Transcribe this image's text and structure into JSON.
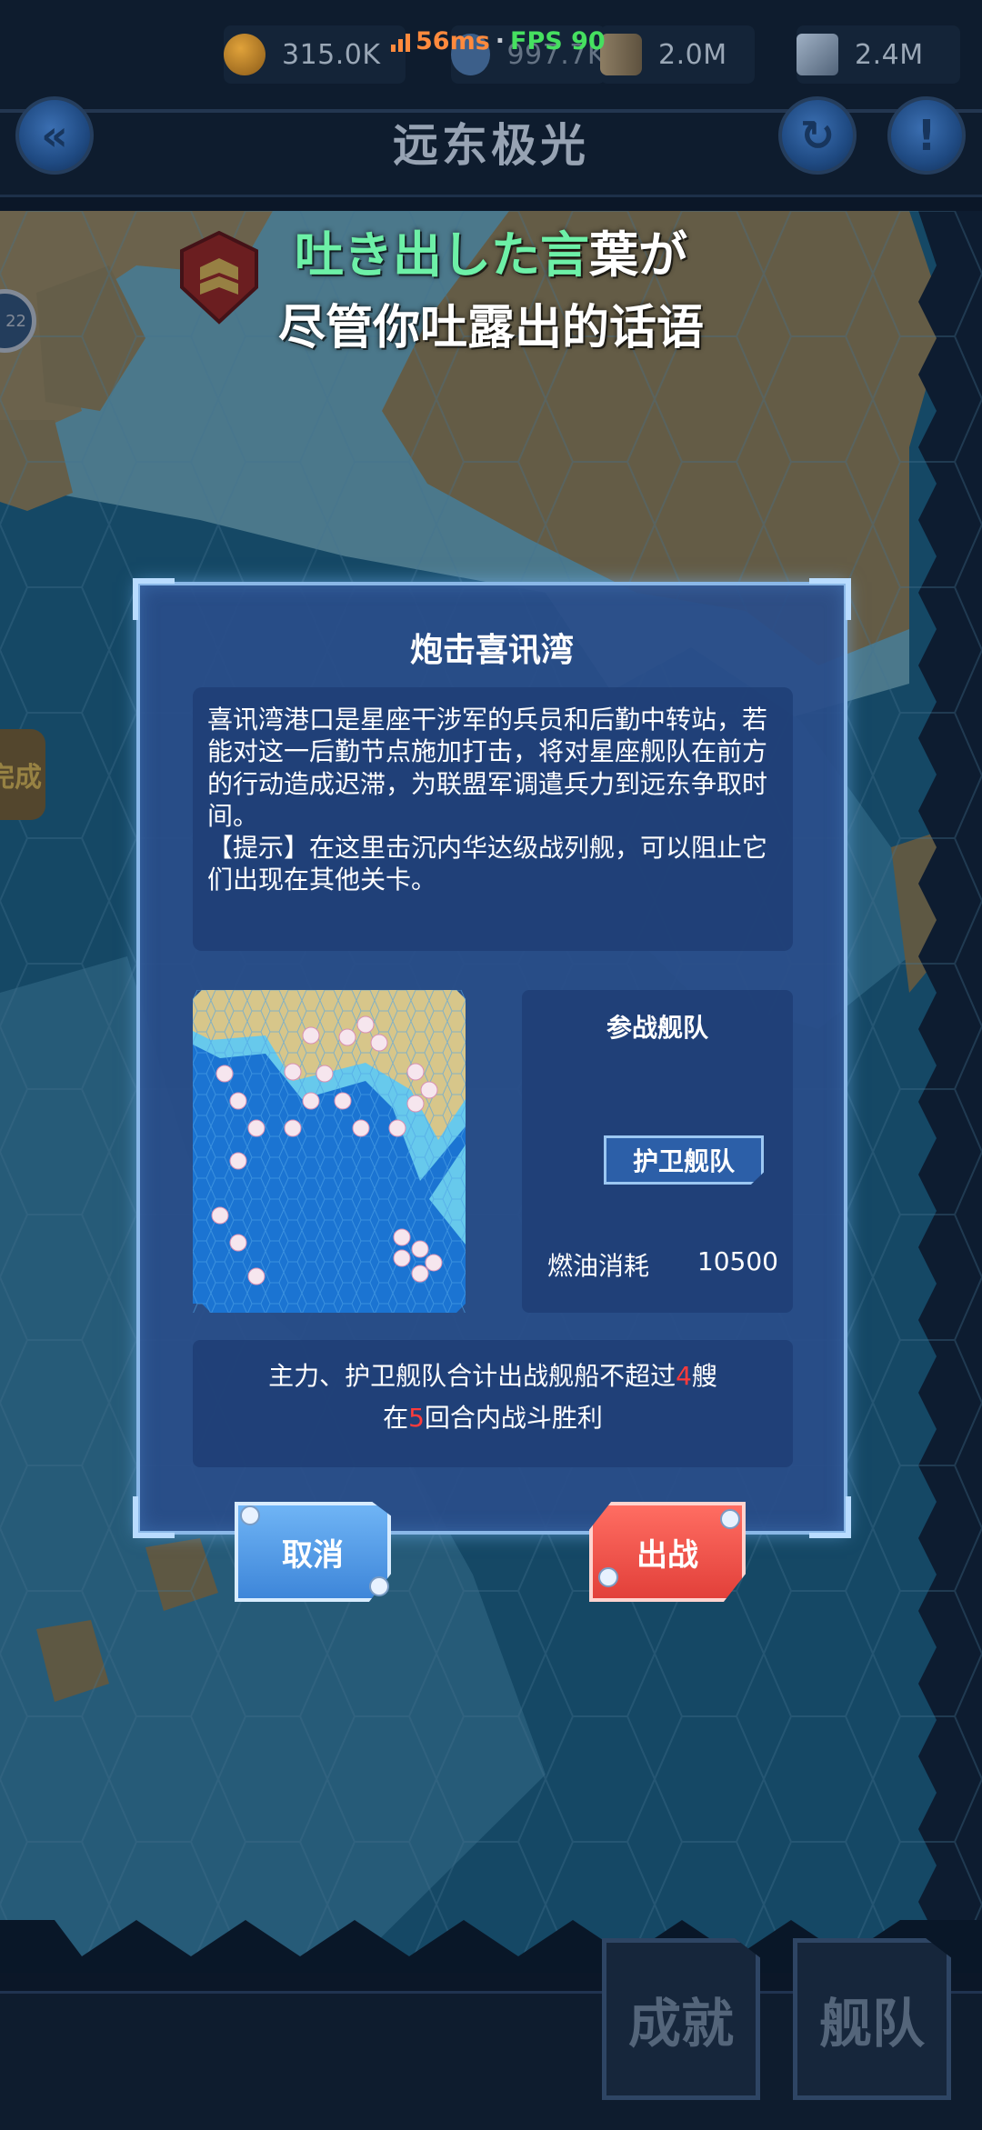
{
  "topbar": {
    "perf_ping": "56ms",
    "perf_sep": "·",
    "perf_fps": "FPS 90",
    "resources": [
      {
        "name": "coin",
        "value": "315.0K"
      },
      {
        "name": "oil",
        "value": "997.7K"
      },
      {
        "name": "ammo",
        "value": "2.0M"
      },
      {
        "name": "steel",
        "value": "2.4M"
      }
    ]
  },
  "header": {
    "title": "远东极光",
    "back_icon": "double-chevron-left-icon",
    "refresh_icon": "refresh-icon",
    "info_icon": "exclamation-icon"
  },
  "lyrics": {
    "line1_green": "吐き出した言",
    "line1_white": "葉が",
    "line2": "尽管你吐露出的话语"
  },
  "map_labels": {
    "node_left_badge": "22",
    "node_left_text": "完成"
  },
  "dialog": {
    "title": "炮击喜讯湾",
    "description": "喜讯湾港口是星座干涉军的兵员和后勤中转站，若能对这一后勤节点施加打击，将对星座舰队在前方的行动造成迟滞，为联盟军调遣兵力到远东争取时间。\n【提示】在这里击沉内华达级战列舰，可以阻止它们出现在其他关卡。",
    "fleet_title": "参战舰队",
    "escort_button": "护卫舰队",
    "fuel_label": "燃油消耗",
    "fuel_value": "10500",
    "condition1_pre": "主力、护卫舰队合计出战舰船不超过",
    "condition1_num": "4",
    "condition1_post": "艘",
    "condition2_pre": "在",
    "condition2_num": "5",
    "condition2_post": "回合内战斗胜利",
    "cancel_button": "取消",
    "sortie_button": "出战"
  },
  "bottom": {
    "achievements": "成就",
    "fleet": "舰队"
  },
  "colors": {
    "accent_green": "#6df0a7",
    "cancel_blue": "#4f9ae6",
    "sortie_red": "#ef4f47",
    "highlight_red": "#ff3b3b"
  }
}
